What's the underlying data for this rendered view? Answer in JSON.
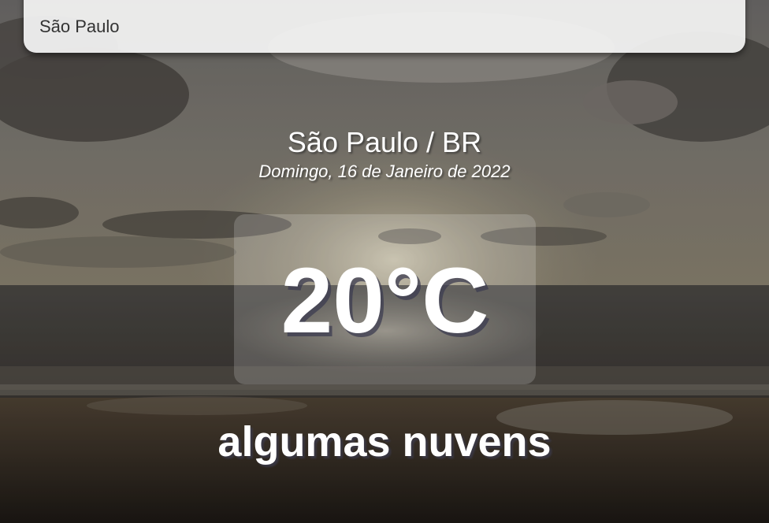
{
  "search": {
    "value": "São Paulo"
  },
  "weather": {
    "location": "São Paulo / BR",
    "date": "Domingo, 16 de Janeiro de 2022",
    "temperature": "20°C",
    "description": "algumas nuvens"
  }
}
